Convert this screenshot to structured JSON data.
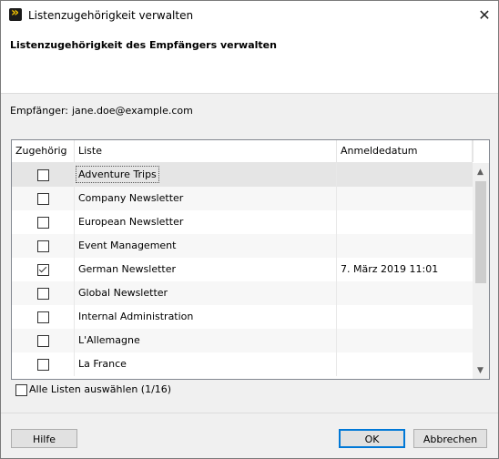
{
  "window": {
    "title": "Listenzugehörigkeit verwalten"
  },
  "header": {
    "title": "Listenzugehörigkeit des Empfängers verwalten"
  },
  "recipient": {
    "label": "Empfänger:",
    "value": "jane.doe@example.com"
  },
  "table": {
    "columns": [
      "Zugehörig",
      "Liste",
      "Anmeldedatum"
    ],
    "rows": [
      {
        "checked": false,
        "list": "Adventure Trips",
        "date": ""
      },
      {
        "checked": false,
        "list": "Company Newsletter",
        "date": ""
      },
      {
        "checked": false,
        "list": "European Newsletter",
        "date": ""
      },
      {
        "checked": false,
        "list": "Event Management",
        "date": ""
      },
      {
        "checked": true,
        "list": "German Newsletter",
        "date": "7. März 2019 11:01"
      },
      {
        "checked": false,
        "list": "Global Newsletter",
        "date": ""
      },
      {
        "checked": false,
        "list": "Internal Administration",
        "date": ""
      },
      {
        "checked": false,
        "list": "L'Allemagne",
        "date": ""
      },
      {
        "checked": false,
        "list": "La France",
        "date": ""
      }
    ]
  },
  "select_all": {
    "label": "Alle Listen auswählen (1/16)"
  },
  "buttons": {
    "help": "Hilfe",
    "ok": "OK",
    "cancel": "Abbrechen"
  }
}
